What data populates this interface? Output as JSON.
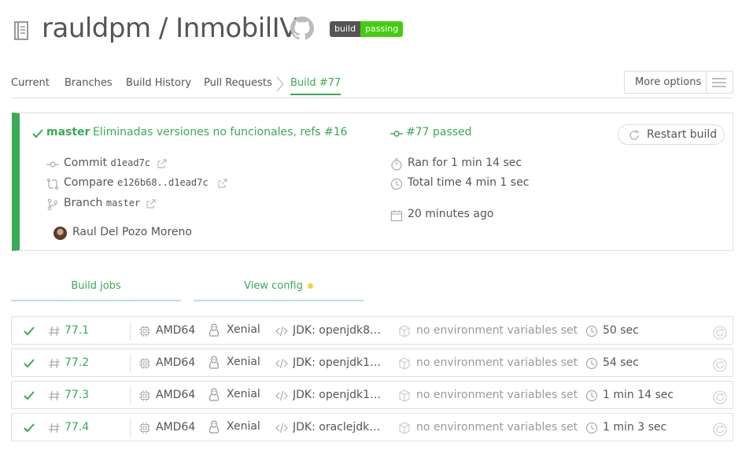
{
  "header": {
    "owner": "rauldpm",
    "separator": " / ",
    "repo": "InmobilIV",
    "badge": {
      "left": "build",
      "right": "passing"
    }
  },
  "tabs": [
    {
      "label": "Current"
    },
    {
      "label": "Branches"
    },
    {
      "label": "Build History"
    },
    {
      "label": "Pull Requests"
    },
    {
      "label": "Build #77",
      "active": true
    }
  ],
  "more_options": {
    "label": "More options"
  },
  "build": {
    "branch": "master",
    "message": "Eliminadas versiones no funcionales, refs #16",
    "commit_label": "Commit",
    "commit_sha": "d1ead7c",
    "compare_label": "Compare",
    "compare_range": "e126b68..d1ead7c",
    "branch_label": "Branch",
    "branch_name": "master",
    "author": "Raul Del Pozo Moreno",
    "status": "#77 passed",
    "ran_for": "Ran for 1 min 14 sec",
    "total_time": "Total time 4 min 1 sec",
    "finished": "20 minutes ago",
    "restart_label": "Restart build"
  },
  "job_tabs": {
    "build_jobs": "Build jobs",
    "view_config": "View config"
  },
  "jobs": [
    {
      "number": "77.1",
      "arch": "AMD64",
      "os": "Xenial",
      "jdk": "JDK: openjdk8 …",
      "env": "no environment variables set",
      "duration": "50 sec"
    },
    {
      "number": "77.2",
      "arch": "AMD64",
      "os": "Xenial",
      "jdk": "JDK: openjdk1…",
      "env": "no environment variables set",
      "duration": "54 sec"
    },
    {
      "number": "77.3",
      "arch": "AMD64",
      "os": "Xenial",
      "jdk": "JDK: openjdk1…",
      "env": "no environment variables set",
      "duration": "1 min 14 sec"
    },
    {
      "number": "77.4",
      "arch": "AMD64",
      "os": "Xenial",
      "jdk": "JDK: oraclejdk…",
      "env": "no environment variables set",
      "duration": "1 min 3 sec"
    }
  ],
  "colors": {
    "passed": "#39aa56",
    "badge_left": "#555555",
    "badge_right": "#44cc11",
    "config_dot": "#f5d536"
  }
}
